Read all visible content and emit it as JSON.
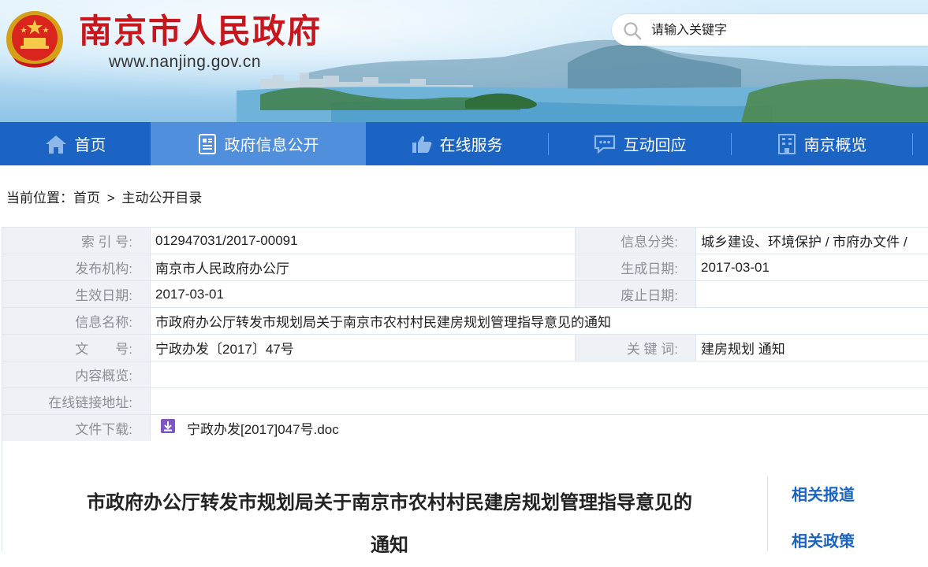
{
  "header": {
    "site_title": "南京市人民政府",
    "site_url": "www.nanjing.gov.cn",
    "search_placeholder": "请输入关键字"
  },
  "nav": {
    "items": [
      {
        "label": "首页",
        "icon": "home-icon",
        "active": false
      },
      {
        "label": "政府信息公开",
        "icon": "document-icon",
        "active": true
      },
      {
        "label": "在线服务",
        "icon": "thumbs-up-icon",
        "active": false
      },
      {
        "label": "互动回应",
        "icon": "chat-icon",
        "active": false
      },
      {
        "label": "南京概览",
        "icon": "building-icon",
        "active": false
      }
    ]
  },
  "breadcrumb": {
    "prefix": "当前位置：",
    "home": "首页",
    "separator": ">",
    "current": "主动公开目录"
  },
  "meta": {
    "index_label": "索 引 号:",
    "index_value": "012947031/2017-00091",
    "category_label": "信息分类:",
    "category_value": "城乡建设、环境保护 / 市府办文件 /",
    "publisher_label": "发布机构:",
    "publisher_value": "南京市人民政府办公厅",
    "created_label": "生成日期:",
    "created_value": "2017-03-01",
    "effective_label": "生效日期:",
    "effective_value": "2017-03-01",
    "expired_label": "废止日期:",
    "expired_value": "",
    "name_label": "信息名称:",
    "name_value": "市政府办公厅转发市规划局关于南京市农村村民建房规划管理指导意见的通知",
    "docno_label": "文　　号:",
    "docno_value": "宁政办发〔2017〕47号",
    "keywords_label": "关 键 词:",
    "keywords_value": "建房规划 通知",
    "summary_label": "内容概览:",
    "summary_value": "",
    "link_label": "在线链接地址:",
    "link_value": "",
    "download_label": "文件下载:",
    "download_file": "宁政办发[2017]047号.doc"
  },
  "article": {
    "title_line1": "市政府办公厅转发市规划局关于南京市农村村民建房规划管理指导意见的",
    "title_line2": "通知"
  },
  "sidebar": {
    "related_news": "相关报道",
    "related_policy": "相关政策"
  },
  "colors": {
    "nav_bg": "#1b64c4",
    "nav_active_bg": "#4f8fdc",
    "title_red": "#c8161d",
    "link_blue": "#1b64c4",
    "label_bg": "#eef2f7"
  }
}
